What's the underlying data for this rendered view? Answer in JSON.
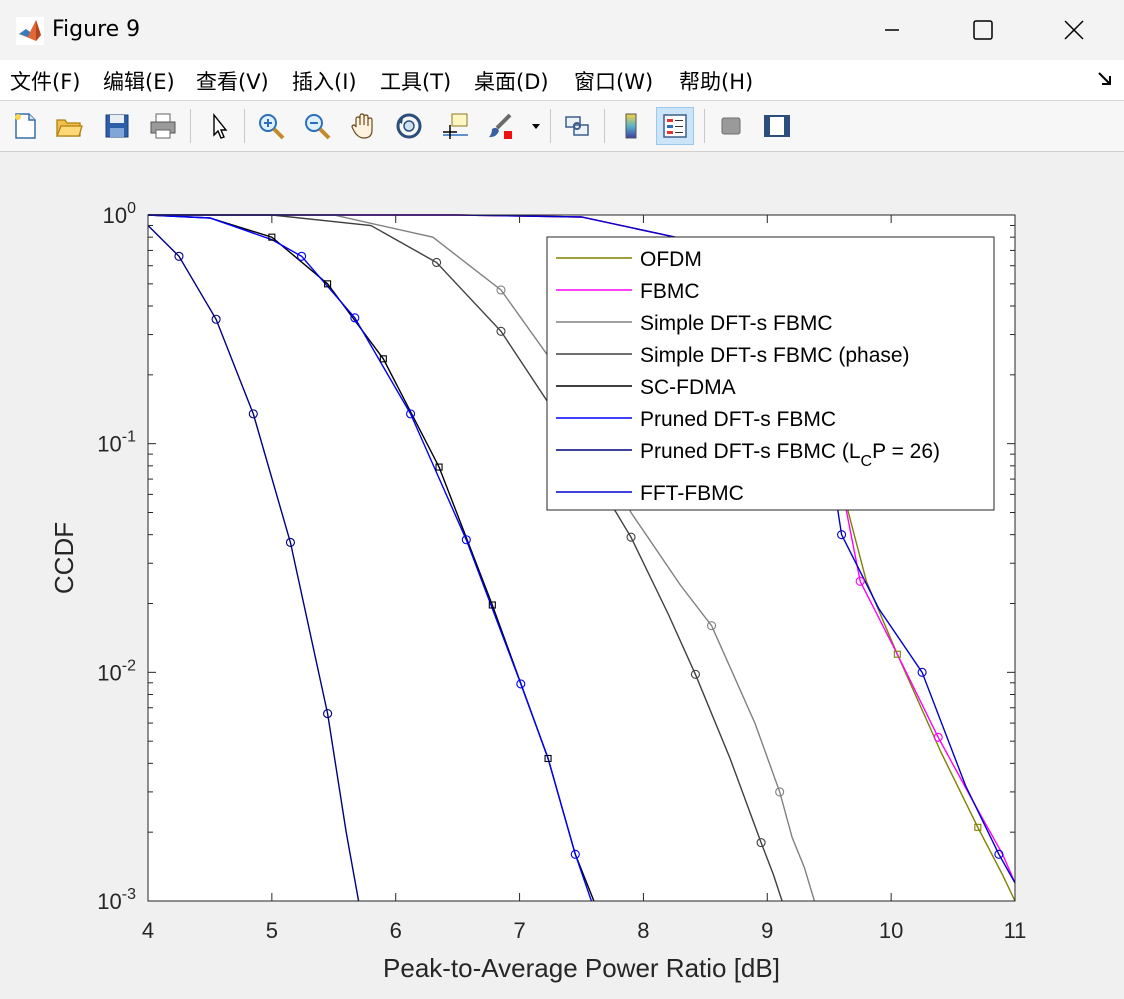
{
  "window": {
    "title": "Figure 9",
    "minimize_icon": "minimize-icon",
    "maximize_icon": "maximize-icon",
    "close_icon": "close-icon"
  },
  "menu": {
    "items": [
      {
        "label": "文件(F)"
      },
      {
        "label": "编辑(E)"
      },
      {
        "label": "查看(V)"
      },
      {
        "label": "插入(I)"
      },
      {
        "label": "工具(T)"
      },
      {
        "label": "桌面(D)"
      },
      {
        "label": "窗口(W)"
      },
      {
        "label": "帮助(H)"
      }
    ]
  },
  "toolbar": {
    "buttons": [
      {
        "icon": "new-figure-icon"
      },
      {
        "icon": "open-file-icon"
      },
      {
        "icon": "save-icon"
      },
      {
        "icon": "print-icon"
      },
      {
        "icon": "pointer-icon"
      },
      {
        "icon": "zoom-in-icon"
      },
      {
        "icon": "zoom-out-icon"
      },
      {
        "icon": "pan-icon"
      },
      {
        "icon": "rotate-3d-icon"
      },
      {
        "icon": "data-cursor-icon"
      },
      {
        "icon": "brush-icon"
      },
      {
        "icon": "link-plot-icon"
      },
      {
        "icon": "colorbar-icon"
      },
      {
        "icon": "legend-icon"
      },
      {
        "icon": "hide-plot-tools-icon"
      },
      {
        "icon": "show-plot-tools-icon"
      }
    ]
  },
  "chart_data": {
    "type": "line",
    "title": "",
    "xlabel": "Peak-to-Average Power Ratio [dB]",
    "ylabel": "CCDF",
    "xlim": [
      4,
      11
    ],
    "ylim": [
      0.001,
      1
    ],
    "yscale": "log",
    "xticks": [
      "4",
      "5",
      "6",
      "7",
      "8",
      "9",
      "10",
      "11"
    ],
    "yticks": [
      {
        "base": "10",
        "exp": "0",
        "value": 1
      },
      {
        "base": "10",
        "exp": "-1",
        "value": 0.1
      },
      {
        "base": "10",
        "exp": "-2",
        "value": 0.01
      },
      {
        "base": "10",
        "exp": "-3",
        "value": 0.001
      }
    ],
    "grid": false,
    "legend_position": "top-right",
    "series": [
      {
        "name": "OFDM",
        "color": "#808000",
        "marker": "square",
        "x": [
          4,
          6.5,
          7.5,
          8.5,
          9.0,
          9.3,
          9.6,
          9.8,
          10.05,
          10.4,
          10.7,
          10.9,
          11
        ],
        "y": [
          1,
          1,
          0.98,
          0.75,
          0.45,
          0.22,
          0.065,
          0.025,
          0.012,
          0.0045,
          0.0021,
          0.0013,
          0.001
        ],
        "markers_x": [
          9.6,
          10.05,
          10.7
        ]
      },
      {
        "name": "FBMC",
        "color": "#ff00ff",
        "marker": "circle",
        "x": [
          4,
          6.5,
          7.5,
          8.5,
          9.0,
          9.3,
          9.6,
          9.75,
          10.05,
          10.38,
          10.7,
          10.9,
          11
        ],
        "y": [
          1,
          1,
          0.98,
          0.75,
          0.45,
          0.22,
          0.065,
          0.025,
          0.012,
          0.0052,
          0.0025,
          0.0016,
          0.0012
        ],
        "markers_x": [
          9.75,
          10.38
        ]
      },
      {
        "name": "Simple DFT-s FBMC",
        "color": "#808080",
        "marker": "circle",
        "x": [
          4,
          5.5,
          6.3,
          6.85,
          7.4,
          7.9,
          8.3,
          8.55,
          8.9,
          9.1,
          9.2,
          9.3,
          9.38
        ],
        "y": [
          1,
          1,
          0.8,
          0.47,
          0.18,
          0.05,
          0.024,
          0.016,
          0.006,
          0.003,
          0.0019,
          0.0014,
          0.001
        ],
        "markers_x": [
          6.85,
          8.55,
          9.1
        ]
      },
      {
        "name": "Simple DFT-s FBMC (phase)",
        "color": "#404040",
        "marker": "circle",
        "x": [
          4,
          5.0,
          5.8,
          6.33,
          6.85,
          7.4,
          7.9,
          8.2,
          8.42,
          8.7,
          8.95,
          9.05,
          9.12
        ],
        "y": [
          1,
          1,
          0.9,
          0.62,
          0.31,
          0.11,
          0.039,
          0.018,
          0.0098,
          0.0042,
          0.0018,
          0.0013,
          0.001
        ],
        "markers_x": [
          6.33,
          6.85,
          7.9,
          8.42,
          8.95
        ]
      },
      {
        "name": "SC-FDMA",
        "color": "#000000",
        "marker": "square",
        "x": [
          4,
          4.5,
          5.0,
          5.45,
          5.9,
          6.35,
          6.78,
          7.23,
          7.45,
          7.6
        ],
        "y": [
          1,
          0.97,
          0.8,
          0.5,
          0.235,
          0.079,
          0.0197,
          0.0042,
          0.0016,
          0.001
        ],
        "markers_x": [
          5.0,
          5.45,
          5.9,
          6.35,
          6.78,
          7.23
        ]
      },
      {
        "name": "Pruned DFT-s FBMC",
        "color": "#0000ff",
        "marker": "circle",
        "x": [
          4,
          4.5,
          5.0,
          5.24,
          5.67,
          6.12,
          6.57,
          7.01,
          7.23,
          7.45,
          7.58
        ],
        "y": [
          1,
          0.97,
          0.78,
          0.66,
          0.355,
          0.135,
          0.038,
          0.0089,
          0.0042,
          0.0016,
          0.001
        ],
        "markers_x": [
          5.24,
          5.67,
          6.12,
          6.57,
          7.01,
          7.45
        ]
      },
      {
        "name": "Pruned DFT-s FBMC (LCP = 26)",
        "name_main": "Pruned DFT-s FBMC (L",
        "name_sub": "C",
        "name_tail": "P = 26)",
        "color": "#000080",
        "marker": "circle",
        "x": [
          4,
          4.25,
          4.55,
          4.85,
          5.15,
          5.45,
          5.6,
          5.7
        ],
        "y": [
          0.9,
          0.66,
          0.35,
          0.135,
          0.037,
          0.0066,
          0.002,
          0.001
        ],
        "markers_x": [
          4.25,
          4.55,
          4.85,
          5.15,
          5.45
        ]
      },
      {
        "name": "FFT-FBMC",
        "color": "#0000cd",
        "marker": "circle",
        "x": [
          4,
          6.5,
          7.5,
          8.5,
          9.1,
          9.4,
          9.6,
          9.9,
          10.25,
          10.6,
          10.87,
          11
        ],
        "y": [
          1,
          1,
          0.98,
          0.75,
          0.45,
          0.2,
          0.04,
          0.019,
          0.01,
          0.0032,
          0.0016,
          0.0012
        ],
        "markers_x": [
          9.6,
          10.25,
          10.87
        ]
      }
    ]
  }
}
